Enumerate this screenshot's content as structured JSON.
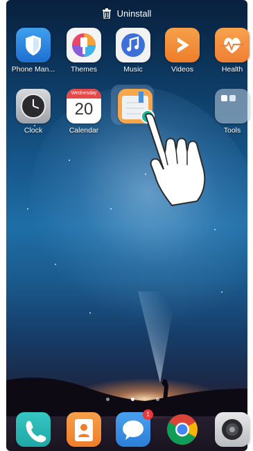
{
  "top_bar": {
    "uninstall_label": "Uninstall"
  },
  "apps": [
    {
      "label": "Phone Man...",
      "icon": "shield-icon"
    },
    {
      "label": "Themes",
      "icon": "paintbrush-icon"
    },
    {
      "label": "Music",
      "icon": "music-note-icon"
    },
    {
      "label": "Videos",
      "icon": "play-icon"
    },
    {
      "label": "Health",
      "icon": "heart-icon"
    },
    {
      "label": "Clock",
      "icon": "clock-icon"
    },
    {
      "label": "Calendar",
      "icon": "calendar-icon"
    },
    {
      "label": "Tools",
      "icon": "folder-icon"
    }
  ],
  "calendar": {
    "weekday": "Wednesday",
    "day": "20"
  },
  "dragged_app": {
    "icon": "notepad-icon"
  },
  "page_indicator": {
    "pages": 3,
    "active": 2
  },
  "dock": [
    {
      "icon": "phone-icon"
    },
    {
      "icon": "contacts-icon"
    },
    {
      "icon": "messaging-icon",
      "badge": "1"
    },
    {
      "icon": "chrome-icon"
    },
    {
      "icon": "camera-icon"
    }
  ]
}
